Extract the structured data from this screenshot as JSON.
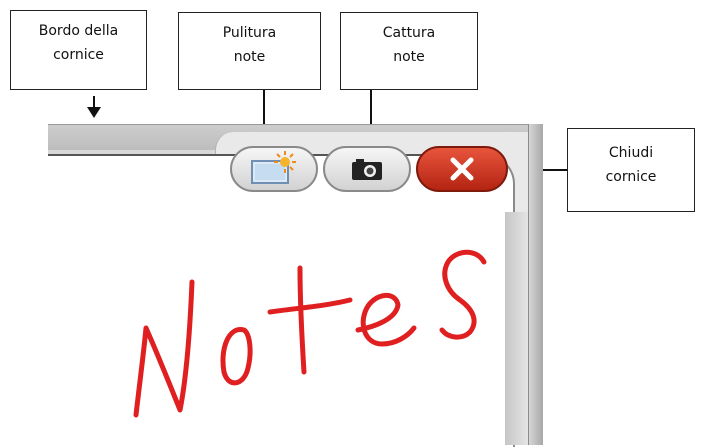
{
  "callouts": {
    "frame_border": {
      "line1": "Bordo della",
      "line2": "cornice"
    },
    "clear_notes": {
      "line1": "Pulitura",
      "line2": "note"
    },
    "capture_notes": {
      "line1": "Cattura",
      "line2": "note"
    },
    "close_frame": {
      "line1": "Chiudi",
      "line2": "cornice"
    }
  },
  "toolbar": {
    "buttons": [
      {
        "name": "clear-notes-button",
        "icon": "screen-sparkle-icon"
      },
      {
        "name": "capture-notes-button",
        "icon": "camera-icon"
      },
      {
        "name": "close-frame-button",
        "icon": "close-x-icon"
      }
    ],
    "close_color": "#c8321d"
  },
  "canvas": {
    "handwritten_text": "Notes",
    "ink_color": "#e02020"
  }
}
